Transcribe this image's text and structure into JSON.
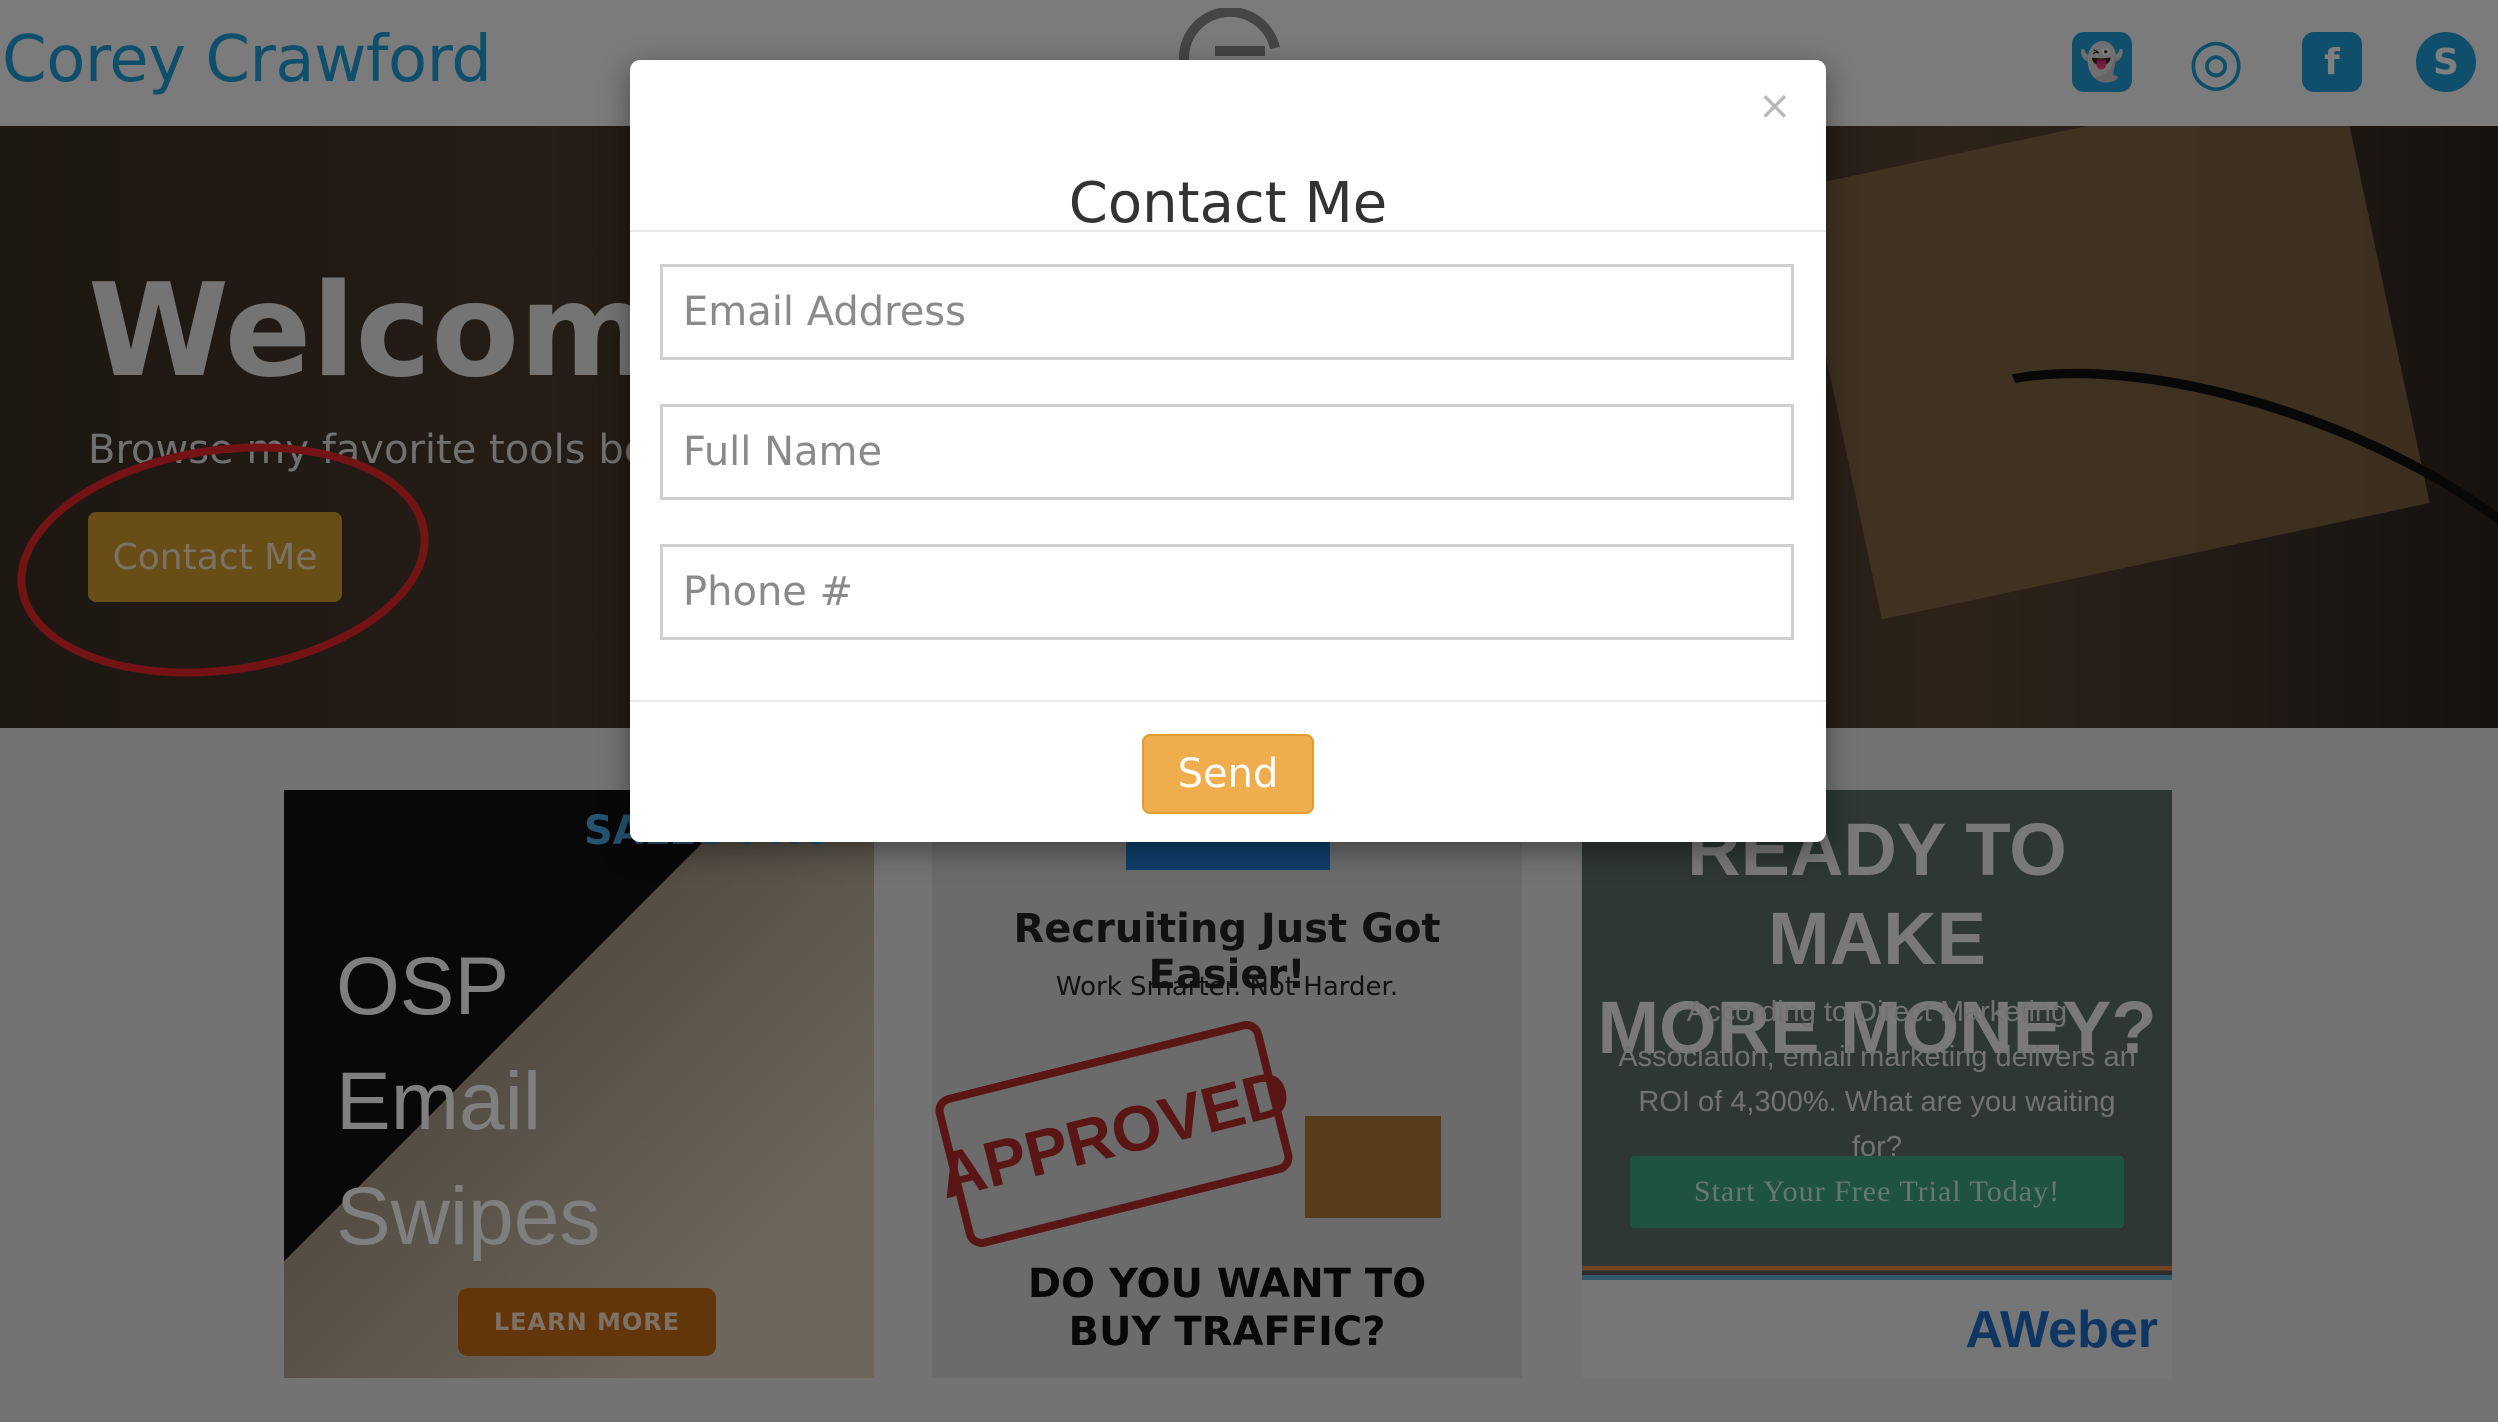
{
  "site": {
    "brand": "Corey Crawford"
  },
  "social": [
    {
      "name": "snapchat",
      "glyph": "👻"
    },
    {
      "name": "instagram",
      "glyph": "◎"
    },
    {
      "name": "facebook",
      "glyph": "f"
    },
    {
      "name": "skype",
      "glyph": "S"
    }
  ],
  "hero": {
    "title": "Welcome",
    "subtitle": "Browse my favorite tools belo",
    "button": "Contact Me"
  },
  "cards": {
    "osp": {
      "logo": "SALES PRO",
      "title": "OSP\nEmail\nSwipes",
      "button": "LEARN MORE"
    },
    "traffic": {
      "headline": "Recruiting Just Got Easier!",
      "subline": "Work Smarter. Not Harder.",
      "stamp": "APPROVED",
      "question": "DO YOU WANT TO\nBUY TRAFFIC?"
    },
    "aweber": {
      "headline": "READY TO MAKE\nMORE MONEY?",
      "body": "According to Direct Marketing Association, email marketing delivers an ROI of 4,300%. What are you waiting for?",
      "cta": "Start Your Free Trial Today!",
      "brand": "AWeber"
    }
  },
  "modal": {
    "title": "Contact Me",
    "close": "×",
    "fields": {
      "email": {
        "placeholder": "Email Address",
        "value": ""
      },
      "name": {
        "placeholder": "Full Name",
        "value": ""
      },
      "phone": {
        "placeholder": "Phone #",
        "value": ""
      }
    },
    "submit": "Send"
  },
  "colors": {
    "brand_blue": "#1e9fd6",
    "send_orange": "#f0ad4e",
    "hero_button": "#d39b2e",
    "highlight": "#e8262b"
  }
}
